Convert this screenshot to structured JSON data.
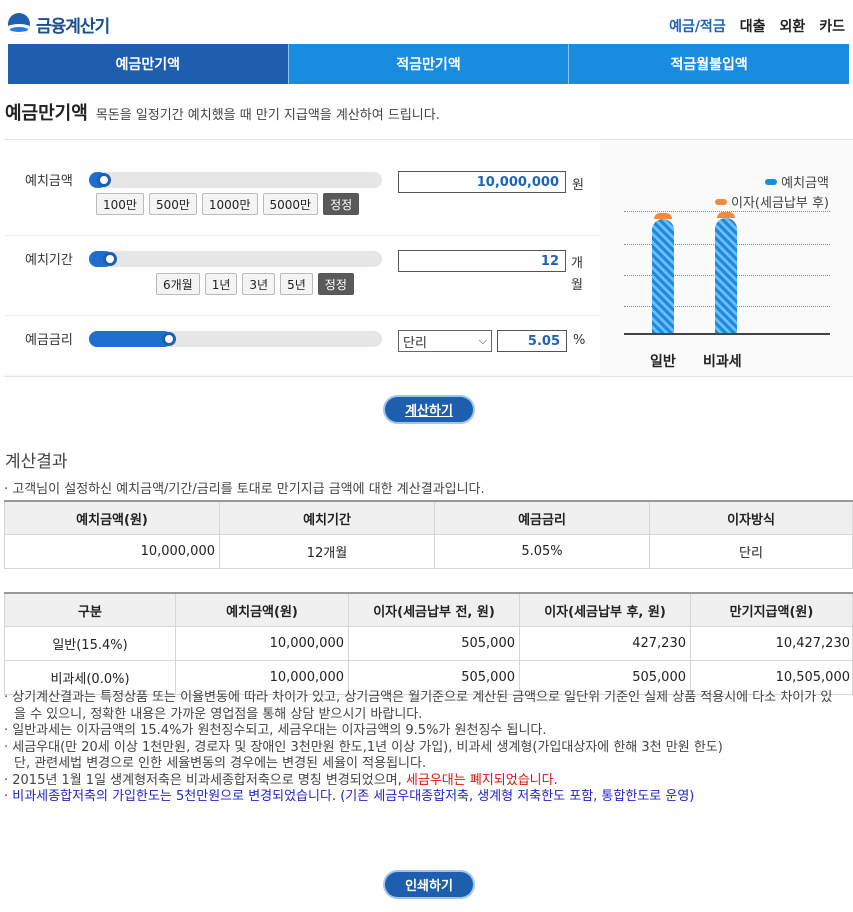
{
  "header": {
    "logo_text": "금융계산기",
    "nav": [
      "예금/적금",
      "대출",
      "외환",
      "카드"
    ]
  },
  "tabs": [
    "예금만기액",
    "적금만기액",
    "적금월불입액"
  ],
  "page": {
    "title": "예금만기액",
    "description": "목돈을 일정기간 예치했을 때 만기 지급액을 계산하여 드립니다."
  },
  "inputs": {
    "deposit": {
      "label": "예치금액",
      "slider_level": 0.03,
      "quick": [
        "100만",
        "500만",
        "1000만",
        "5000만",
        "정정"
      ],
      "value": "10,000,000",
      "unit": "원"
    },
    "period": {
      "label": "예치기간",
      "slider_level": 0.05,
      "quick": [
        "6개월",
        "1년",
        "3년",
        "5년",
        "정정"
      ],
      "value": "12",
      "unit": "개월"
    },
    "rate": {
      "label": "예금금리",
      "slider_level": 0.26,
      "type_selected": "단리",
      "value": "5.05",
      "unit": "%"
    }
  },
  "chart": {
    "legend": [
      "예치금액",
      "이자(세금납부 후)"
    ],
    "categories": [
      "일반",
      "비과세"
    ],
    "colors": {
      "deposit": "#1a8ce0",
      "interest": "#f08a3c"
    }
  },
  "chart_data": {
    "type": "bar",
    "categories": [
      "일반",
      "비과세"
    ],
    "series": [
      {
        "name": "예치금액",
        "values": [
          10000000,
          10000000
        ]
      },
      {
        "name": "이자(세금납부 후)",
        "values": [
          427230,
          505000
        ]
      }
    ],
    "stacked": true,
    "grid": true,
    "legend_position": "top-right"
  },
  "buttons": {
    "calculate": "계산하기",
    "print": "인쇄하기"
  },
  "result": {
    "title": "계산결과",
    "note": "· 고객님이 설정하신 예치금액/기간/금리를 토대로 만기지급 금액에 대한 계산결과입니다.",
    "summary_headers": [
      "예치금액(원)",
      "예치기간",
      "예금금리",
      "이자방식"
    ],
    "summary_row": [
      "10,000,000",
      "12개월",
      "5.05%",
      "단리"
    ],
    "detail_headers": [
      "구분",
      "예치금액(원)",
      "이자(세금납부 전, 원)",
      "이자(세금납부 후, 원)",
      "만기지급액(원)"
    ],
    "detail_rows": [
      [
        "일반(15.4%)",
        "10,000,000",
        "505,000",
        "427,230",
        "10,427,230"
      ],
      [
        "비과세(0.0%)",
        "10,000,000",
        "505,000",
        "505,000",
        "10,505,000"
      ]
    ]
  },
  "notes": {
    "n1": "· 상기계산결과는 특정상품 또는 이율변동에 따라 차이가 있고, 상기금액은 월기준으로 계산된 금액으로 일단위 기준인 실제 상품 적용시에 다소 차이가 있을 수 있으니, 정확한 내용은 가까운 영업점을 통해 상담 받으시기 바랍니다.",
    "n2": "· 일반과세는 이자금액의 15.4%가 원천징수되고, 세금우대는 이자금액의 9.5%가 원천징수 됩니다.",
    "n3": "· 세금우대(만 20세 이상 1천만원, 경로자 및 장애인 3천만원 한도,1년 이상 가입), 비과세 생계형(가입대상자에 한해 3천 만원 한도)",
    "n3b": "단, 관련세법 변경으로 인한 세율변동의 경우에는 변경된 세율이 적용됩니다.",
    "n4a": "· 2015년 1월 1일 생계형저축은 비과세종합저축으로 명칭 변경되었으며, ",
    "n4b": "세금우대는 폐지되었습니다.",
    "n5": "· 비과세종합저축의 가입한도는 5천만원으로 변경되었습니다. (기존 세금우대종합저축, 생계형 저축한도 포함, 통합한도로 운영)"
  }
}
